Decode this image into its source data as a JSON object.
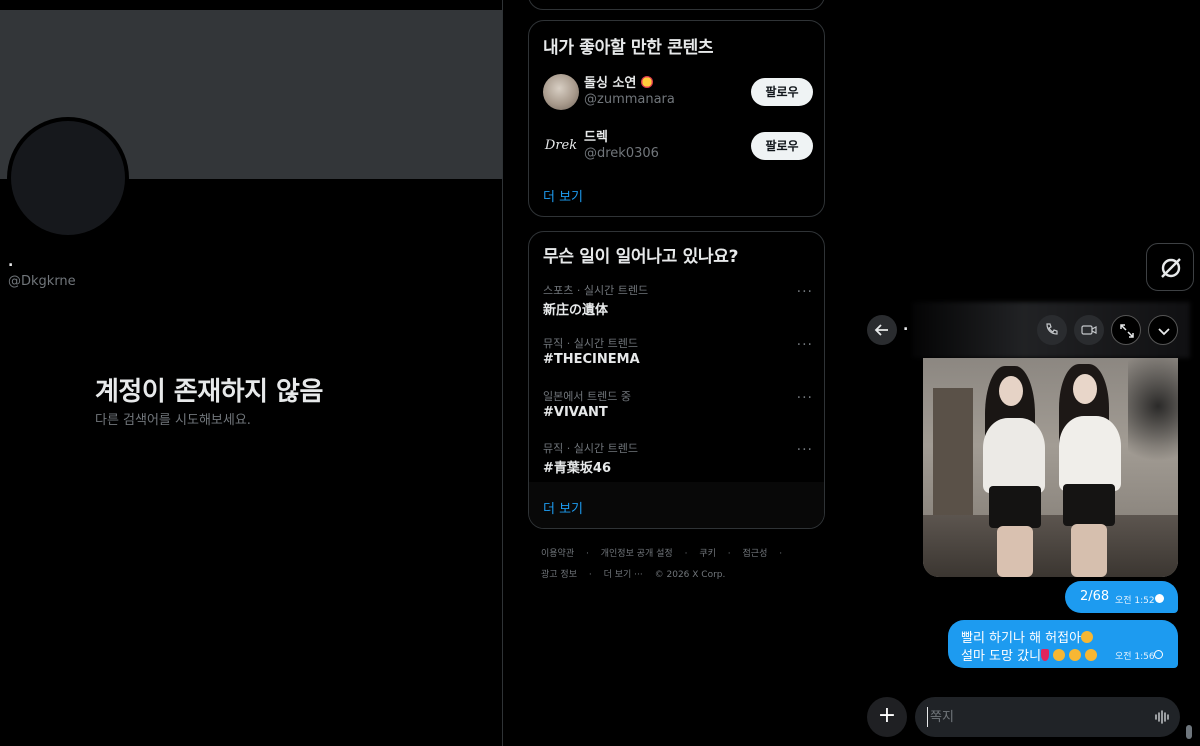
{
  "profile": {
    "name": ".",
    "handle": "@Dkgkrne",
    "empty_title": "계정이 존재하지 않음",
    "empty_subtitle": "다른 검색어를 시도해보세요."
  },
  "who_to_follow": {
    "title": "내가 좋아할 만한 콘텐츠",
    "users": [
      {
        "name": "돌싱 소연",
        "handle": "@zummanara",
        "button": "팔로우",
        "avatar_text": ""
      },
      {
        "name": "드렉",
        "handle": "@drek0306",
        "button": "팔로우",
        "avatar_text": "Drek"
      }
    ],
    "more": "더 보기"
  },
  "trends": {
    "title": "무슨 일이 일어나고 있나요?",
    "items": [
      {
        "category": "스포츠 · 실시간 트렌드",
        "name": "新庄の遺体"
      },
      {
        "category": "뮤직 · 실시간 트렌드",
        "name": "#THECINEMA"
      },
      {
        "category": "일본에서 트렌드 중",
        "name": "#VIVANT"
      },
      {
        "category": "뮤직 · 실시간 트렌드",
        "name": "#青葉坂46"
      }
    ],
    "more_dots": "···",
    "more": "더 보기"
  },
  "footer": {
    "row1": [
      "이용약관",
      "·",
      "개인정보 공개 설정",
      "·",
      "쿠키",
      "·",
      "접근성",
      "·"
    ],
    "row2": [
      "광고 정보",
      "·",
      "더 보기 ···",
      "© 2026 X Corp."
    ]
  },
  "dm": {
    "title": ".",
    "messages": [
      {
        "text": "2/68",
        "time": "오전 1:52"
      },
      {
        "line1": "빨리 하기나 해 허접아",
        "line2": "설마 도망 갔니",
        "time": "오전 1:56"
      }
    ],
    "compose_placeholder": "쪽지",
    "icons": {
      "back": "arrow-left-icon",
      "call": "phone-icon",
      "video": "video-icon",
      "popout": "expand-icon",
      "collapse": "chevron-down-icon",
      "grok": "grok-icon",
      "add": "plus-icon",
      "voice": "waveform-icon"
    }
  },
  "colors": {
    "accent": "#1d9bf0",
    "background": "#000000",
    "banner": "#333639",
    "muted_text": "#71767b",
    "border": "#2f3336"
  }
}
